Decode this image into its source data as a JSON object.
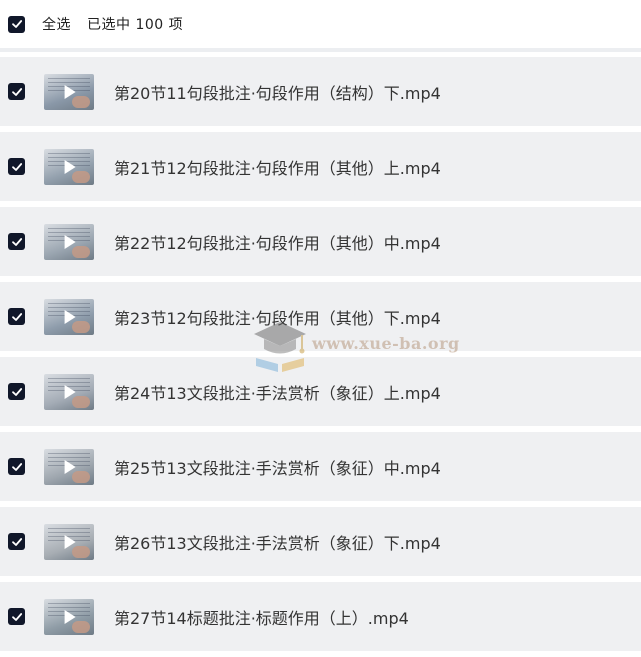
{
  "header": {
    "select_all_label": "全选",
    "selected_count_text": "已选中  100  项",
    "checked": true
  },
  "files": [
    {
      "name": "第20节11句段批注·句段作用（结构）下.mp4",
      "checked": true,
      "thumb_color": "#8a98a8"
    },
    {
      "name": "第21节12句段批注·句段作用（其他）上.mp4",
      "checked": true,
      "thumb_color": "#93a0ad"
    },
    {
      "name": "第22节12句段批注·句段作用（其他）中.mp4",
      "checked": true,
      "thumb_color": "#9aa5b0"
    },
    {
      "name": "第23节12句段批注·句段作用（其他）下.mp4",
      "checked": true,
      "thumb_color": "#8e9cab"
    },
    {
      "name": "第24节13文段批注·手法赏析（象征）上.mp4",
      "checked": true,
      "thumb_color": "#a3abb5"
    },
    {
      "name": "第25节13文段批注·手法赏析（象征）中.mp4",
      "checked": true,
      "thumb_color": "#9ea6ae"
    },
    {
      "name": "第26节13文段批注·手法赏析（象征）下.mp4",
      "checked": true,
      "thumb_color": "#a7adb3"
    },
    {
      "name": "第27节14标题批注·标题作用（上）.mp4",
      "checked": true,
      "thumb_color": "#8f9ca6"
    }
  ],
  "watermark": {
    "text": "www.xue-ba.org"
  },
  "colors": {
    "checkbox": "#10172a",
    "row_background": "#eff0f2",
    "text": "#333333"
  }
}
